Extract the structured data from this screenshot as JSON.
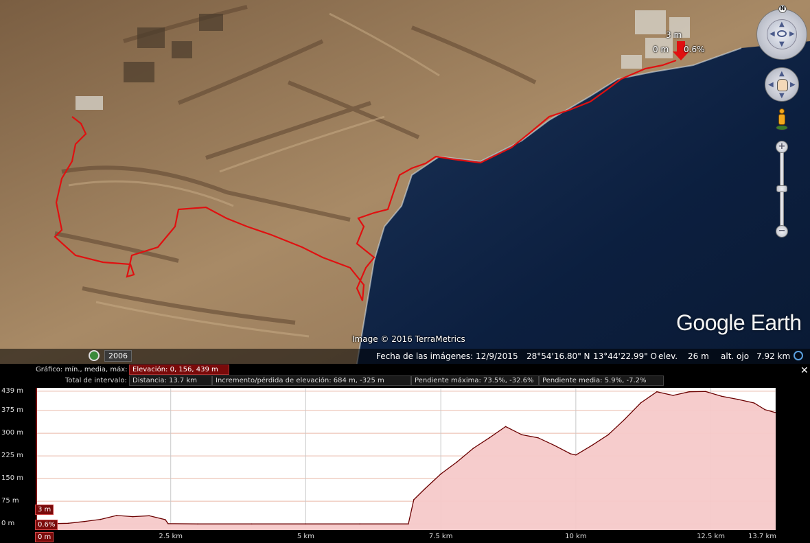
{
  "map": {
    "route_color": "#e01010",
    "sea_color": "#0c1f3f",
    "land_color": "#9c7d5c",
    "cursor_labels": {
      "elevation": "3 m",
      "distance": "0 m",
      "slope": "0.6%"
    },
    "image_credit": "Image © 2016 TerraMetrics",
    "watermark_google": "Google",
    "watermark_earth": "Earth"
  },
  "navigation": {
    "north_label": "N",
    "zoom_in": "+",
    "zoom_out": "−",
    "icons": [
      "compass-icon",
      "hand-pan-icon",
      "pegman-icon"
    ]
  },
  "statusbar": {
    "year": "2006",
    "imagery_date": "Fecha de las imágenes: 12/9/2015",
    "latitude": "28°54'16.80\" N",
    "longitude": "13°44'22.99\" O",
    "elev_label": "elev.",
    "elev_value": "26 m",
    "eye_label": "alt. ojo",
    "eye_value": "7.92 km"
  },
  "profile": {
    "graph_label": "Gráfico: mín., media, máx:",
    "elevation_summary": "Elevación: 0, 156, 439 m",
    "interval_label": "Total de intervalo:",
    "distance": "Distancia: 13.7 km",
    "gain_loss": "Incremento/pérdida de elevación: 684 m, -325 m",
    "max_slope": "Pendiente máxima: 73.5%, -32.6%",
    "avg_slope": "Pendiente media: 5.9%, -7.2%",
    "close_label": "✕",
    "cursor_tags": {
      "elevation": "3 m",
      "slope": "0.6%",
      "distance": "0 m"
    },
    "fill_color": "#f6c9c9",
    "line_color": "#6a0000"
  },
  "chart_data": {
    "type": "area",
    "xlabel": "",
    "ylabel": "",
    "x_unit": "km",
    "y_unit": "m",
    "xlim": [
      0,
      13.7
    ],
    "ylim": [
      -20,
      450
    ],
    "y_ticks": [
      "439 m",
      "375 m",
      "300 m",
      "225 m",
      "150 m",
      "75 m",
      "0 m"
    ],
    "y_tick_values": [
      439,
      375,
      300,
      225,
      150,
      75,
      0
    ],
    "x_ticks": [
      "0 m",
      "2.5 km",
      "5 km",
      "7.5 km",
      "10 km",
      "12.5 km",
      "13.7 km"
    ],
    "x_tick_values": [
      0,
      2.5,
      5,
      7.5,
      10,
      12.5,
      13.7
    ],
    "x": [
      0,
      0.3,
      0.6,
      0.9,
      1.2,
      1.5,
      1.8,
      2.1,
      2.4,
      2.45,
      3.0,
      4.0,
      5.0,
      6.0,
      6.9,
      7.0,
      7.2,
      7.5,
      7.8,
      8.1,
      8.4,
      8.7,
      9.0,
      9.3,
      9.6,
      9.9,
      10.0,
      10.3,
      10.6,
      10.9,
      11.2,
      11.5,
      11.8,
      12.1,
      12.4,
      12.7,
      13.0,
      13.3,
      13.5,
      13.7
    ],
    "y": [
      3,
      1,
      2,
      8,
      15,
      28,
      24,
      27,
      14,
      1,
      0,
      0,
      0,
      0,
      0,
      80,
      115,
      165,
      205,
      250,
      285,
      322,
      295,
      285,
      260,
      232,
      228,
      260,
      295,
      345,
      400,
      437,
      425,
      437,
      438,
      422,
      412,
      400,
      378,
      368
    ],
    "grid": true
  }
}
